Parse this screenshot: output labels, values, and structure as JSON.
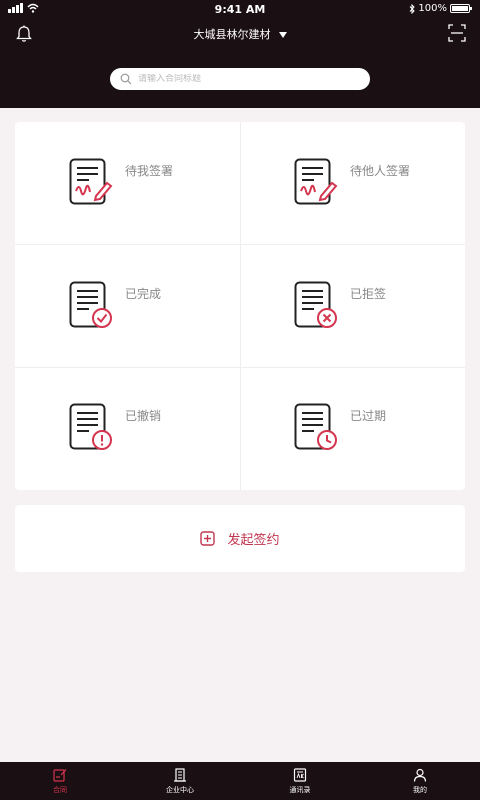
{
  "status": {
    "time": "9:41 AM",
    "battery": "100%"
  },
  "header": {
    "company": "大城县林尔建材"
  },
  "search": {
    "placeholder": "请输入合同标题"
  },
  "grid": {
    "items": [
      {
        "label": "待我签署",
        "icon": "sign-document-icon"
      },
      {
        "label": "待他人签署",
        "icon": "sign-document-icon"
      },
      {
        "label": "已完成",
        "icon": "document-check-icon"
      },
      {
        "label": "已拒签",
        "icon": "document-x-icon"
      },
      {
        "label": "已撤销",
        "icon": "document-alert-icon"
      },
      {
        "label": "已过期",
        "icon": "document-clock-icon"
      }
    ]
  },
  "start": {
    "label": "发起签约"
  },
  "tabs": [
    {
      "label": "合同",
      "icon": "contract-icon",
      "active": true
    },
    {
      "label": "企业中心",
      "icon": "building-icon",
      "active": false
    },
    {
      "label": "通讯录",
      "icon": "contacts-icon",
      "active": false
    },
    {
      "label": "我的",
      "icon": "user-icon",
      "active": false
    }
  ],
  "colors": {
    "accent": "#d4354f",
    "header_bg": "#1a0f12",
    "page_bg": "#f6f1f3"
  }
}
